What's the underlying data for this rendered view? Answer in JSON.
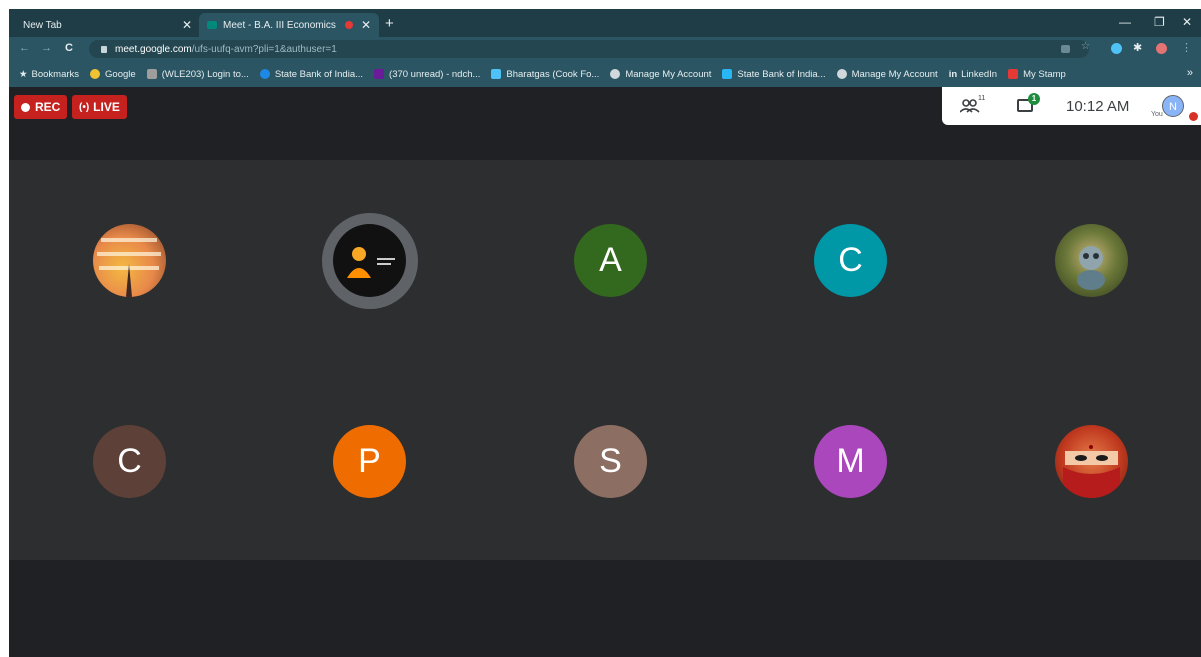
{
  "browser": {
    "tabs": [
      {
        "title": "New Tab",
        "active": false
      },
      {
        "title": "Meet - B.A. III Economics",
        "active": true
      }
    ],
    "url_host": "meet.google.com",
    "url_path": "/ufs-uufq-avm?pli=1&authuser=1",
    "bookmarks": [
      {
        "label": "Bookmarks",
        "icon": "star-icon",
        "color": "#e6eef0"
      },
      {
        "label": "Google",
        "icon": "google-icon",
        "color": "#f1c232"
      },
      {
        "label": "(WLE203) Login to...",
        "icon": "page-icon",
        "color": "#9e9e9e"
      },
      {
        "label": "State Bank of India...",
        "icon": "sbi-icon",
        "color": "#1e88e5"
      },
      {
        "label": "(370 unread) - ndch...",
        "icon": "yahoo-mail-icon",
        "color": "#6a1b9a"
      },
      {
        "label": "Bharatgas (Cook Fo...",
        "icon": "bharatgas-icon",
        "color": "#4fc3f7"
      },
      {
        "label": "Manage My Account",
        "icon": "globe-icon",
        "color": "#cfd8dc"
      },
      {
        "label": "State Bank of India...",
        "icon": "sbi-icon",
        "color": "#29b6f6"
      },
      {
        "label": "Manage My Account",
        "icon": "globe-icon",
        "color": "#cfd8dc"
      },
      {
        "label": "LinkedIn",
        "icon": "linkedin-icon",
        "color": "#e6eef0"
      },
      {
        "label": "My Stamp",
        "icon": "stamp-icon",
        "color": "#e53935"
      }
    ]
  },
  "meet": {
    "rec_label": "REC",
    "live_label": "LIVE",
    "people_count": "11",
    "chat_badge": "1",
    "time": "10:12 AM",
    "you_label": "You",
    "self_initial": "N",
    "participants": [
      {
        "initial": "",
        "type": "photo",
        "icon": "quote-photo-icon"
      },
      {
        "initial": "",
        "type": "photo",
        "icon": "buddha-photo-icon",
        "speaking": true
      },
      {
        "initial": "A",
        "type": "letter",
        "color": "#33691e"
      },
      {
        "initial": "C",
        "type": "letter",
        "color": "#0097a7"
      },
      {
        "initial": "",
        "type": "photo",
        "icon": "cartoon-photo-icon"
      },
      {
        "initial": "C",
        "type": "letter",
        "color": "#5d4037"
      },
      {
        "initial": "P",
        "type": "letter",
        "color": "#ef6c00"
      },
      {
        "initial": "S",
        "type": "letter",
        "color": "#8d6e63"
      },
      {
        "initial": "M",
        "type": "letter",
        "color": "#ab47bc"
      },
      {
        "initial": "",
        "type": "photo",
        "icon": "masked-face-photo-icon"
      }
    ]
  }
}
